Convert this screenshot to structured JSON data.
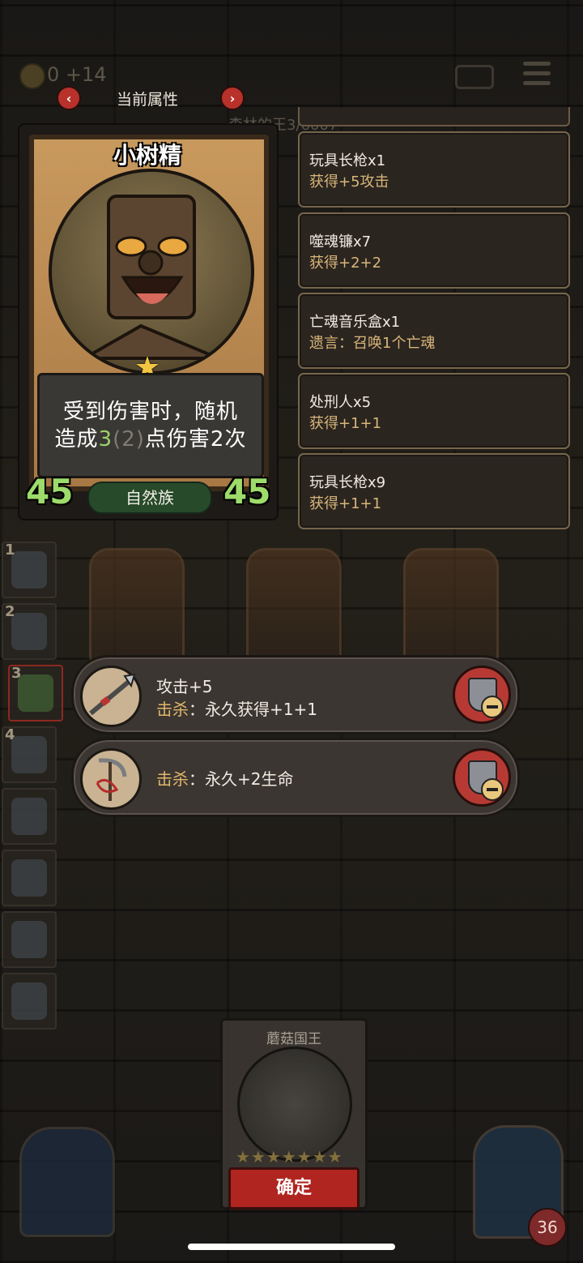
{
  "header": {
    "title": "当前属性",
    "faded_name": "森林的王3/6007"
  },
  "status": {
    "coins": "0 +14",
    "battery_icon": "battery-charging-icon",
    "menu_icon": "menu-icon"
  },
  "card": {
    "name": "小树精",
    "star_count": 1,
    "desc_line1": "受到伤害时，随机",
    "desc_prefix": "造成",
    "desc_value": "3",
    "desc_base": "(2)",
    "desc_suffix": "点伤害2次",
    "attack": "45",
    "health": "45",
    "tribe": "自然族"
  },
  "buffs": [
    {
      "name": "玩具长枪x1",
      "effect": "获得+5攻击"
    },
    {
      "name": "噬魂镰x7",
      "effect": "获得+2+2"
    },
    {
      "name": "亡魂音乐盒x1",
      "effect": "遗言：召唤1个亡魂"
    },
    {
      "name": "处刑人x5",
      "effect": "获得+1+1"
    },
    {
      "name": "玩具长枪x9",
      "effect": "获得+1+1"
    }
  ],
  "abilities": [
    {
      "line1": "攻击+5",
      "kill_label": "击杀",
      "line2_rest": "：永久获得+1+1"
    },
    {
      "kill_label": "击杀",
      "line_rest": "：永久+2生命"
    }
  ],
  "sidebar": [
    {
      "num": "1"
    },
    {
      "num": "2"
    },
    {
      "num": "3"
    },
    {
      "num": "4"
    }
  ],
  "bottom": {
    "king_name": "蘑菇国王",
    "king_stars": "★★★★★★★",
    "confirm_label": "确定",
    "hero_hp": "36"
  }
}
